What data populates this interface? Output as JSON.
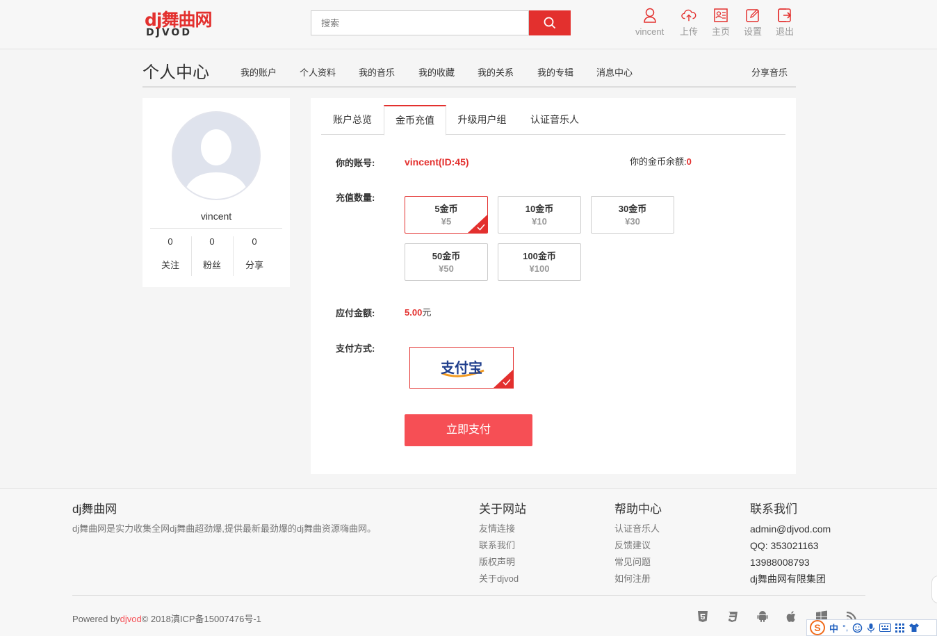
{
  "header": {
    "logo_top": "dj舞曲网",
    "logo_bottom": "DJVOD",
    "search_placeholder": "搜索",
    "nav": [
      {
        "label": "vincent",
        "icon": "user-icon"
      },
      {
        "label": "上传",
        "icon": "cloud-upload-icon"
      },
      {
        "label": "主页",
        "icon": "profile-card-icon"
      },
      {
        "label": "设置",
        "icon": "edit-icon"
      },
      {
        "label": "退出",
        "icon": "logout-icon"
      }
    ]
  },
  "subnav": {
    "title": "个人中心",
    "items": [
      "我的账户",
      "个人资料",
      "我的音乐",
      "我的收藏",
      "我的关系",
      "我的专辑",
      "消息中心"
    ],
    "share": "分享音乐"
  },
  "profile": {
    "username": "vincent",
    "stats": [
      {
        "value": "0",
        "label": "关注"
      },
      {
        "value": "0",
        "label": "粉丝"
      },
      {
        "value": "0",
        "label": "分享"
      }
    ]
  },
  "tabs": [
    "账户总览",
    "金币充值",
    "升级用户组",
    "认证音乐人"
  ],
  "recharge": {
    "account_label": "你的账号:",
    "account_value": "vincent(ID:45)",
    "balance_label": "你的金币余额:",
    "balance_value": "0",
    "amount_label": "充值数量:",
    "options": [
      {
        "coins": "5金币",
        "price": "¥5",
        "selected": true
      },
      {
        "coins": "10金币",
        "price": "¥10",
        "selected": false
      },
      {
        "coins": "30金币",
        "price": "¥30",
        "selected": false
      },
      {
        "coins": "50金币",
        "price": "¥50",
        "selected": false
      },
      {
        "coins": "100金币",
        "price": "¥100",
        "selected": false
      }
    ],
    "payable_label": "应付金额:",
    "payable_value": "5.00",
    "payable_unit": "元",
    "method_label": "支付方式:",
    "method_name": "支付宝",
    "pay_button": "立即支付"
  },
  "footer": {
    "brand_title": "dj舞曲网",
    "brand_desc": "dj舞曲网是实力收集全网dj舞曲超劲爆,提供最新最劲爆的dj舞曲资源嗨曲网。",
    "about_title": "关于网站",
    "about_links": [
      "友情连接",
      "联系我们",
      "版权声明",
      "关于djvod"
    ],
    "help_title": "帮助中心",
    "help_links": [
      "认证音乐人",
      "反馈建议",
      "常见问题",
      "如何注册"
    ],
    "contact_title": "联系我们",
    "contact_lines": [
      "admin@djvod.com",
      "QQ: 353021163",
      "13988008793",
      "dj舞曲网有限集团"
    ],
    "copyright_prefix": "Powered by",
    "copyright_brand": "djvod",
    "copyright_suffix": "© 2018滇ICP备15007476号-1",
    "platform_icons": [
      "html5-icon",
      "css3-icon",
      "android-icon",
      "apple-icon",
      "windows-icon",
      "rss-icon"
    ]
  },
  "ime": {
    "logo": "S",
    "mode": "中",
    "punct": "°,"
  },
  "colors": {
    "accent": "#e3302e",
    "button": "#f64f55"
  }
}
